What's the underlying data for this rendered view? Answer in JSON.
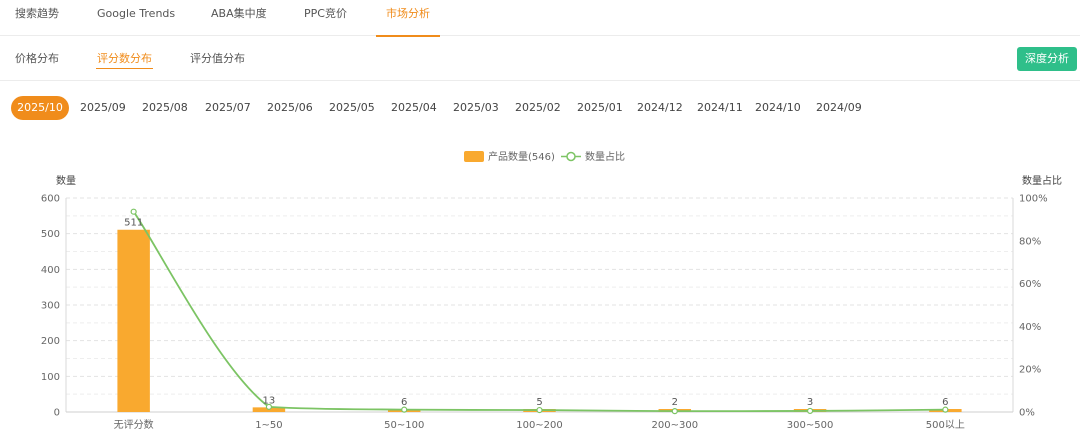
{
  "top_tabs": [
    {
      "label": "搜索趋势",
      "active": false
    },
    {
      "label": "Google Trends",
      "active": false
    },
    {
      "label": "ABA集中度",
      "active": false
    },
    {
      "label": "PPC竞价",
      "active": false
    },
    {
      "label": "市场分析",
      "active": true
    }
  ],
  "sub_tabs": [
    {
      "label": "价格分布",
      "active": false
    },
    {
      "label": "评分数分布",
      "active": true
    },
    {
      "label": "评分值分布",
      "active": false
    }
  ],
  "deep_analysis_label": "深度分析",
  "months": [
    {
      "label": "2025/10",
      "active": true
    },
    {
      "label": "2025/09",
      "active": false
    },
    {
      "label": "2025/08",
      "active": false
    },
    {
      "label": "2025/07",
      "active": false
    },
    {
      "label": "2025/06",
      "active": false
    },
    {
      "label": "2025/05",
      "active": false
    },
    {
      "label": "2025/04",
      "active": false
    },
    {
      "label": "2025/03",
      "active": false
    },
    {
      "label": "2025/02",
      "active": false
    },
    {
      "label": "2025/01",
      "active": false
    },
    {
      "label": "2024/12",
      "active": false
    },
    {
      "label": "2024/11",
      "active": false
    },
    {
      "label": "2024/10",
      "active": false
    },
    {
      "label": "2024/09",
      "active": false
    }
  ],
  "colors": {
    "accent": "#f08c1b",
    "bar": "#f9a92f",
    "line": "#7cc464",
    "button": "#2fbf8a"
  },
  "chart_data": {
    "type": "bar",
    "categories": [
      "无评分数",
      "1~50",
      "50~100",
      "100~200",
      "200~300",
      "300~500",
      "500以上"
    ],
    "series": [
      {
        "name": "产品数量(546)",
        "type": "bar",
        "axis": "left",
        "values": [
          511,
          13,
          6,
          5,
          2,
          3,
          6
        ]
      },
      {
        "name": "数量占比",
        "type": "line",
        "axis": "right",
        "smooth": true,
        "values": [
          93.6,
          2.4,
          1.1,
          0.9,
          0.4,
          0.5,
          1.1
        ]
      }
    ],
    "ylabel": "数量",
    "ylabel_right": "数量占比",
    "ylim": [
      0,
      600
    ],
    "yticks": [
      "0",
      "100",
      "200",
      "300",
      "400",
      "500",
      "600"
    ],
    "ylim_right": [
      0,
      100
    ],
    "yticks_right": [
      "0%",
      "20%",
      "40%",
      "60%",
      "80%",
      "100%"
    ],
    "data_labels": [
      "511",
      "13",
      "6",
      "5",
      "2",
      "3",
      "6"
    ],
    "legend_position": "top-center",
    "grid": true
  }
}
